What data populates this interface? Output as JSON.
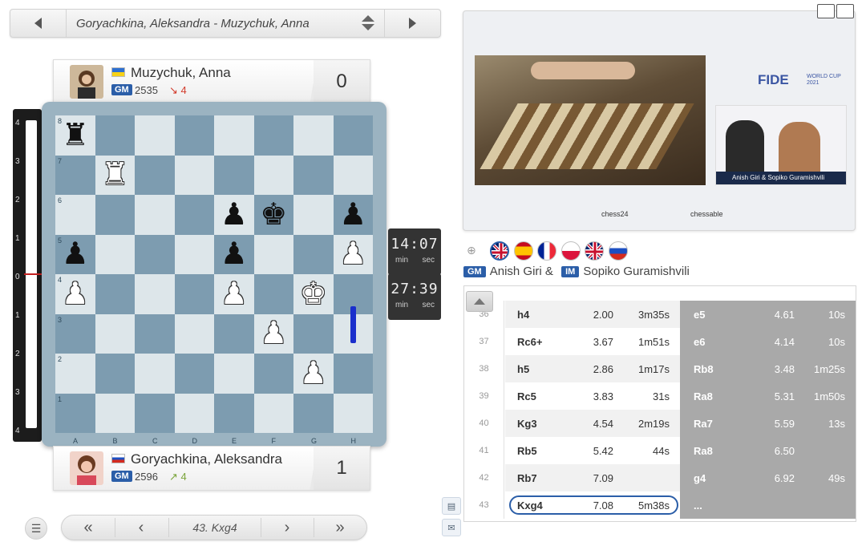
{
  "game": {
    "title": "Goryachkina, Aleksandra - Muzychuk, Anna"
  },
  "top_player": {
    "name": "Muzychuk, Anna",
    "title": "GM",
    "rating": "2535",
    "delta": "↘ 4",
    "score": "0",
    "flag": "ukraine"
  },
  "bottom_player": {
    "name": "Goryachkina, Aleksandra",
    "title": "GM",
    "rating": "2596",
    "delta": "↗ 4",
    "score": "1",
    "flag": "russia"
  },
  "eval_labels": [
    "4",
    "3",
    "2",
    "1",
    "0",
    "1",
    "2",
    "3",
    "4"
  ],
  "board": {
    "ranks": [
      "8",
      "7",
      "6",
      "5",
      "4",
      "3",
      "2",
      "1"
    ],
    "files": [
      "A",
      "B",
      "C",
      "D",
      "E",
      "F",
      "G",
      "H"
    ],
    "position": [
      [
        "bR",
        "",
        "",
        "",
        "",
        "",
        "",
        ""
      ],
      [
        "",
        "wR",
        "",
        "",
        "",
        "",
        "",
        ""
      ],
      [
        "",
        "",
        "",
        "",
        "bP",
        "bK",
        "",
        "bP"
      ],
      [
        "bP",
        "",
        "",
        "",
        "bP",
        "",
        "",
        "wP"
      ],
      [
        "wP",
        "",
        "",
        "",
        "wP",
        "",
        "wK",
        ""
      ],
      [
        "",
        "",
        "",
        "",
        "",
        "wP",
        "",
        ""
      ],
      [
        "",
        "",
        "",
        "",
        "",
        "",
        "wP",
        ""
      ],
      [
        "",
        "",
        "",
        "",
        "",
        "",
        "",
        ""
      ]
    ]
  },
  "clocks": {
    "top": {
      "time": "14:07",
      "min": "min",
      "sec": "sec"
    },
    "bottom": {
      "time": "27:39",
      "min": "min",
      "sec": "sec"
    }
  },
  "nav": {
    "current_move": "43. Kxg4",
    "first": "«",
    "prev": "‹",
    "next": "›",
    "last": "»"
  },
  "video": {
    "fide_logo": "FIDE",
    "fide_sub1": "WORLD CUP",
    "fide_sub2": "2021",
    "cam_caption": "Anish Giri & Sopiko Guramishvili",
    "sponsor_left": "chess24",
    "sponsor_right": "chessable"
  },
  "commentators": {
    "flags": [
      "uk",
      "spain",
      "france",
      "poland",
      "uk",
      "russia"
    ],
    "title1": "GM",
    "name1": "Anish Giri &",
    "title2": "IM",
    "name2": "Sopiko Guramishvili"
  },
  "moves": [
    {
      "num": "36",
      "w": "h4",
      "we": "2.00",
      "wt": "3m35s",
      "b": "e5",
      "be": "4.61",
      "bt": "10s"
    },
    {
      "num": "37",
      "w": "Rc6+",
      "we": "3.67",
      "wt": "1m51s",
      "b": "e6",
      "be": "4.14",
      "bt": "10s"
    },
    {
      "num": "38",
      "w": "h5",
      "we": "2.86",
      "wt": "1m17s",
      "b": "Rb8",
      "be": "3.48",
      "bt": "1m25s"
    },
    {
      "num": "39",
      "w": "Rc5",
      "we": "3.83",
      "wt": "31s",
      "b": "Ra8",
      "be": "5.31",
      "bt": "1m50s"
    },
    {
      "num": "40",
      "w": "Kg3",
      "we": "4.54",
      "wt": "2m19s",
      "b": "Ra7",
      "be": "5.59",
      "bt": "13s"
    },
    {
      "num": "41",
      "w": "Rb5",
      "we": "5.42",
      "wt": "44s",
      "b": "Ra8",
      "be": "6.50",
      "bt": ""
    },
    {
      "num": "42",
      "w": "Rb7",
      "we": "7.09",
      "wt": "",
      "b": "g4",
      "be": "6.92",
      "bt": "49s"
    },
    {
      "num": "43",
      "w": "Kxg4",
      "we": "7.08",
      "wt": "5m38s",
      "b": "...",
      "be": "",
      "bt": ""
    }
  ],
  "colors": {
    "accent": "#2b5ea8",
    "board_light": "#dde6ea",
    "board_dark": "#7d9cb0",
    "arrow": "#1a2fcc"
  }
}
